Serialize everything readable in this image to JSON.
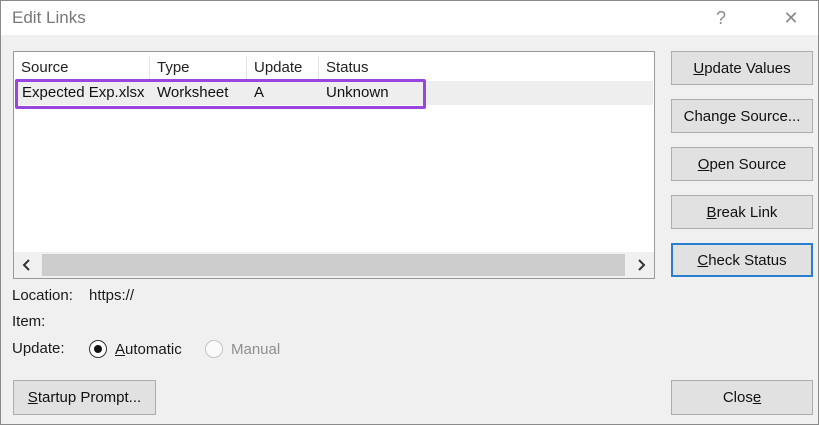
{
  "window": {
    "title": "Edit Links",
    "help_glyph": "?",
    "close_glyph": "✕"
  },
  "list": {
    "columns": [
      "Source",
      "Type",
      "Update",
      "Status"
    ],
    "rows": [
      {
        "source": "Expected Exp.xlsx",
        "type": "Worksheet",
        "update": "A",
        "status": "Unknown"
      }
    ],
    "highlight_color": "#9b45e0"
  },
  "buttons": {
    "update_values": {
      "pre": "",
      "key": "U",
      "post": "pdate Values"
    },
    "change_source": {
      "pre": "Chan",
      "key": "g",
      "post": "e Source..."
    },
    "open_source": {
      "pre": "",
      "key": "O",
      "post": "pen Source"
    },
    "break_link": {
      "pre": "",
      "key": "B",
      "post": "reak Link"
    },
    "check_status": {
      "pre": "",
      "key": "C",
      "post": "heck Status"
    },
    "startup_prompt": {
      "pre": "",
      "key": "S",
      "post": "tartup Prompt..."
    },
    "close": {
      "pre": "Clos",
      "key": "e",
      "post": ""
    }
  },
  "info": {
    "location_label": "Location:",
    "location_value": "https://",
    "item_label": "Item:",
    "item_value": "",
    "update_label": "Update:"
  },
  "update_mode": {
    "automatic": {
      "pre": "",
      "key": "A",
      "post": "utomatic",
      "selected": true
    },
    "manual": {
      "label": "Manual",
      "enabled": false
    }
  },
  "colors": {
    "default_button_border": "#2b7dd1",
    "scroll_thumb": "#cdcdcd"
  }
}
